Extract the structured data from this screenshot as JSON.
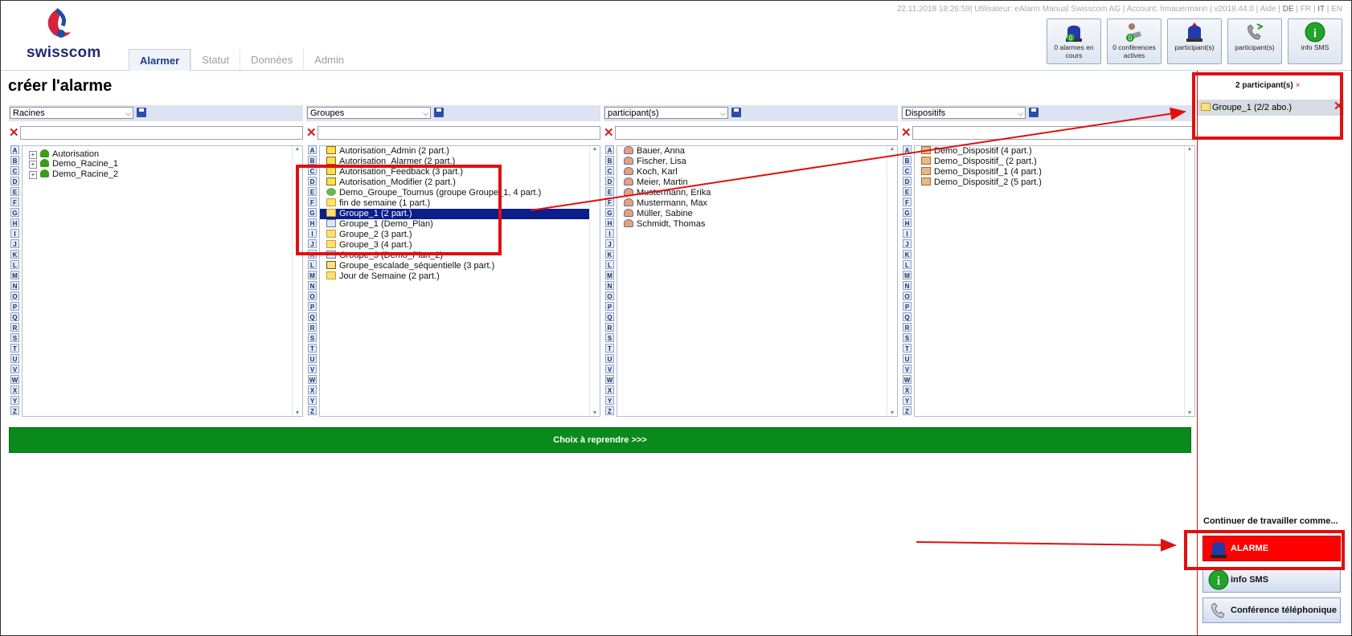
{
  "brand": {
    "name": "swisscom"
  },
  "header": {
    "info": {
      "datetime": "22.11.2018 18:26:59",
      "user": "Utilisateur: eAlarm Manual Swisscom AG",
      "account": "Account: hmauermann",
      "version": "v2018.44.0",
      "help": "Aide",
      "languages": [
        "DE",
        "FR",
        "IT",
        "EN"
      ]
    },
    "tabs": [
      "Alarmer",
      "Statut",
      "Données",
      "Admin"
    ],
    "buttons": [
      {
        "label": "0 alarmes en cours",
        "badge": "0",
        "icon": "siren-icon"
      },
      {
        "label": "0 conférences actives",
        "badge": "0",
        "icon": "conference-icon"
      },
      {
        "label": "participant(s)",
        "icon": "siren-icon"
      },
      {
        "label": "participant(s)",
        "icon": "phone-icon"
      },
      {
        "label": "info SMS",
        "icon": "info-icon"
      }
    ]
  },
  "page_title": "créer l'alarme",
  "alphabet": [
    "A",
    "B",
    "C",
    "D",
    "E",
    "F",
    "G",
    "H",
    "I",
    "J",
    "K",
    "L",
    "M",
    "N",
    "O",
    "P",
    "Q",
    "R",
    "S",
    "T",
    "U",
    "V",
    "W",
    "X",
    "Y",
    "Z"
  ],
  "columns": [
    {
      "select": "Racines",
      "items": [
        {
          "label": "Autorisation",
          "icon": "tree-icon",
          "expandable": true
        },
        {
          "label": "Demo_Racine_1",
          "icon": "tree-icon",
          "expandable": true
        },
        {
          "label": "Demo_Racine_2",
          "icon": "tree-icon",
          "expandable": true
        }
      ]
    },
    {
      "select": "Groupes",
      "items": [
        {
          "label": "Autorisation_Admin (2 part.)",
          "icon": "key-icon"
        },
        {
          "label": "Autorisation_Alarmer (2 part.)",
          "icon": "key-icon"
        },
        {
          "label": "Autorisation_Feedback (3 part.)",
          "icon": "key-icon"
        },
        {
          "label": "Autorisation_Modifier (2 part.)",
          "icon": "key-icon"
        },
        {
          "label": "Demo_Groupe_Tournus (groupe Groupe_1, 4 part.)",
          "icon": "rotation-icon"
        },
        {
          "label": "fin de semaine (1 part.)",
          "icon": "folder-icon"
        },
        {
          "label": "Groupe_1 (2 part.)",
          "icon": "folder-icon",
          "selected": true
        },
        {
          "label": "Groupe_1 (Demo_Plan)",
          "icon": "plan-icon"
        },
        {
          "label": "Groupe_2 (3 part.)",
          "icon": "folder-icon"
        },
        {
          "label": "Groupe_3 (4 part.)",
          "icon": "folder-icon"
        },
        {
          "label": "Groupe_3 (Demo_Plan_2)",
          "icon": "plan-icon"
        },
        {
          "label": "Groupe_escalade_séquentielle (3 part.)",
          "icon": "escalation-icon"
        },
        {
          "label": "Jour de Semaine (2 part.)",
          "icon": "folder-icon"
        }
      ]
    },
    {
      "select": "participant(s)",
      "items": [
        {
          "label": "Bauer, Anna",
          "icon": "person-icon"
        },
        {
          "label": "Fischer, Lisa",
          "icon": "person-icon"
        },
        {
          "label": "Koch, Karl",
          "icon": "person-icon"
        },
        {
          "label": "Meier, Martin",
          "icon": "person-icon"
        },
        {
          "label": "Mustermann, Erika",
          "icon": "person-icon"
        },
        {
          "label": "Mustermann, Max",
          "icon": "person-icon"
        },
        {
          "label": "Müller, Sabine",
          "icon": "person-icon"
        },
        {
          "label": "Schmidt, Thomas",
          "icon": "person-icon"
        }
      ]
    },
    {
      "select": "Dispositifs",
      "items": [
        {
          "label": "Demo_Dispositif (4 part.)",
          "icon": "device-icon"
        },
        {
          "label": "Demo_Dispositif_ (2 part.)",
          "icon": "device-icon"
        },
        {
          "label": "Demo_Dispositif_1 (4 part.)",
          "icon": "device-icon"
        },
        {
          "label": "Demo_Dispositif_2 (5 part.)",
          "icon": "device-icon"
        }
      ]
    }
  ],
  "choice_button": "Choix à reprendre >>>",
  "right_panel": {
    "title": "2 participant(s)",
    "remove_symbol": "×",
    "selected": [
      "Groupe_1 (2/2 abo.)"
    ],
    "continue_label": "Continuer de travailler comme...",
    "actions": [
      "ALARME",
      "info SMS",
      "Conférence téléphonique"
    ]
  },
  "colors": {
    "brand": "#222b6b",
    "selection": "#0b1e8c",
    "choice_bar": "#0a8a1a",
    "alarm": "#ff0000",
    "annotation": "#e01010"
  }
}
